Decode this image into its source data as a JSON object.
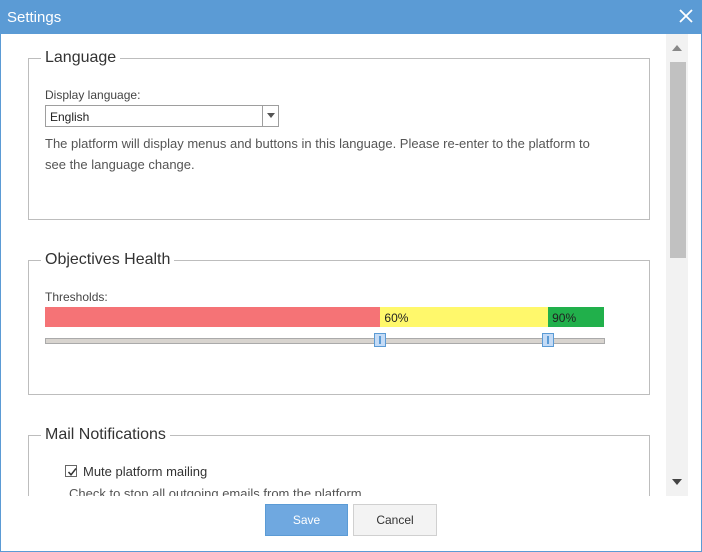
{
  "dialog": {
    "title": "Settings",
    "close_icon": "close-icon",
    "accent_color": "#5b9bd5"
  },
  "language": {
    "legend": "Language",
    "field_label": "Display language:",
    "selected": "English",
    "help_line1": "The platform will display menus and buttons in this language. Please re-enter to the platform to",
    "help_line2": "see the language change."
  },
  "objectives": {
    "legend": "Objectives Health",
    "thresholds_label": "Thresholds:",
    "low_threshold": 60,
    "high_threshold": 90,
    "low_label": "60%",
    "high_label": "90%",
    "colors": {
      "red": "#f57376",
      "yellow": "#fff86b",
      "green": "#21b04b"
    }
  },
  "mail": {
    "legend": "Mail Notifications",
    "mute_label": "Mute platform mailing",
    "mute_checked": true,
    "help": "Check to stop all outgoing emails from the platform."
  },
  "footer": {
    "save_label": "Save",
    "cancel_label": "Cancel"
  }
}
